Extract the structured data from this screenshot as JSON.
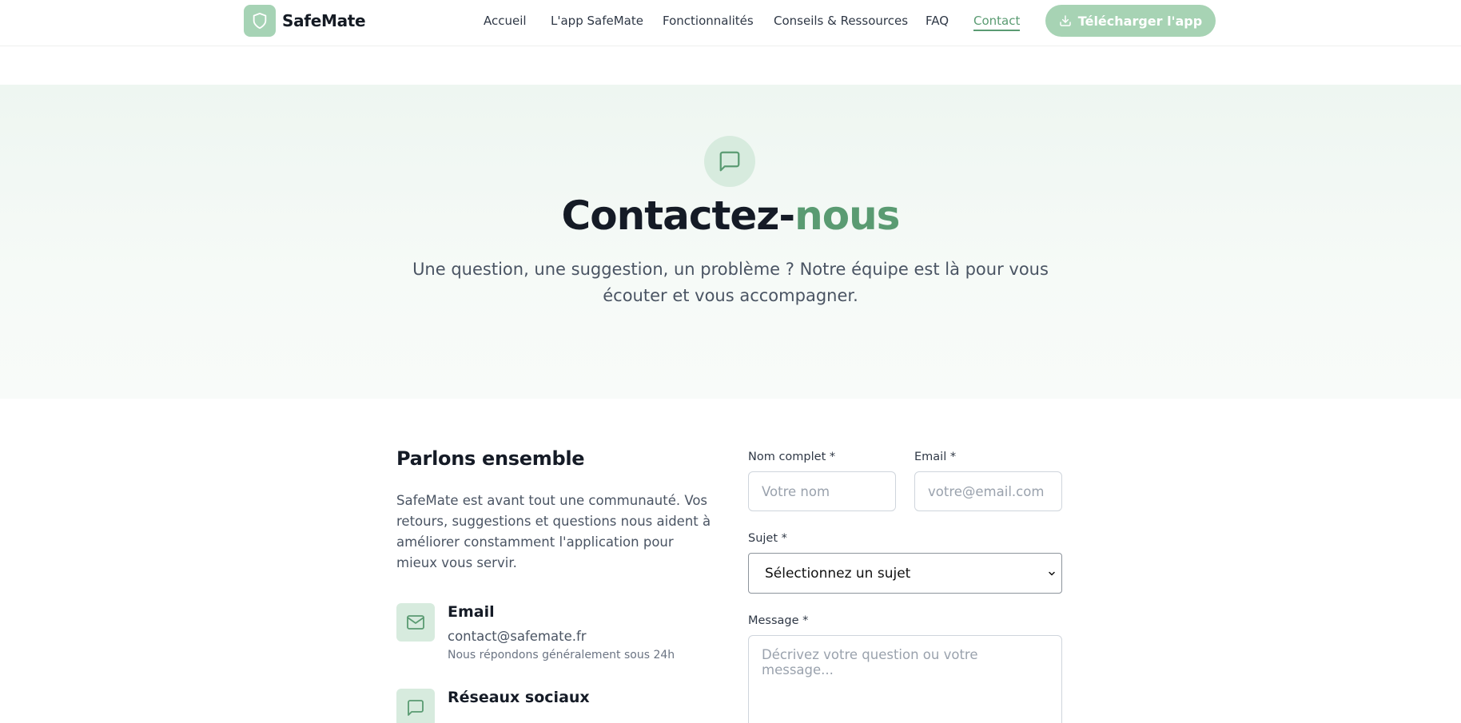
{
  "brand": {
    "name": "SafeMate",
    "logo_icon": "shield-icon"
  },
  "nav": {
    "items": [
      {
        "label": "Accueil",
        "active": false
      },
      {
        "label": "L'app SafeMate",
        "active": false
      },
      {
        "label": "Fonctionnalités",
        "active": false
      },
      {
        "label": "Conseils & Ressources",
        "active": false
      },
      {
        "label": "FAQ",
        "active": false
      },
      {
        "label": "Contact",
        "active": true
      }
    ],
    "cta_label": "Télécharger l'app",
    "cta_icon": "download-icon"
  },
  "hero": {
    "icon": "message-square-icon",
    "title_main": "Contactez-",
    "title_accent": "nous",
    "subtitle": "Une question, une suggestion, un problème ? Notre équipe est là pour vous écouter et vous accompagner."
  },
  "info": {
    "heading": "Parlons ensemble",
    "intro": "SafeMate est avant tout une communauté. Vos retours, suggestions et questions nous aident à améliorer constamment l'application pour mieux vous servir.",
    "email": {
      "icon": "mail-icon",
      "title": "Email",
      "value": "contact@safemate.fr",
      "note": "Nous répondons généralement sous 24h"
    },
    "social": {
      "icon": "message-square-icon",
      "title": "Réseaux sociaux"
    }
  },
  "form": {
    "name_label": "Nom complet *",
    "name_placeholder": "Votre nom",
    "email_label": "Email *",
    "email_placeholder": "votre@email.com",
    "subject_label": "Sujet *",
    "subject_value": "Sélectionnez un sujet",
    "message_label": "Message *",
    "message_placeholder": "Décrivez votre question ou votre message..."
  },
  "colors": {
    "accent": "#5a9b72",
    "accent_light": "#a7d3b4",
    "icon_bg": "#d7ebde"
  }
}
